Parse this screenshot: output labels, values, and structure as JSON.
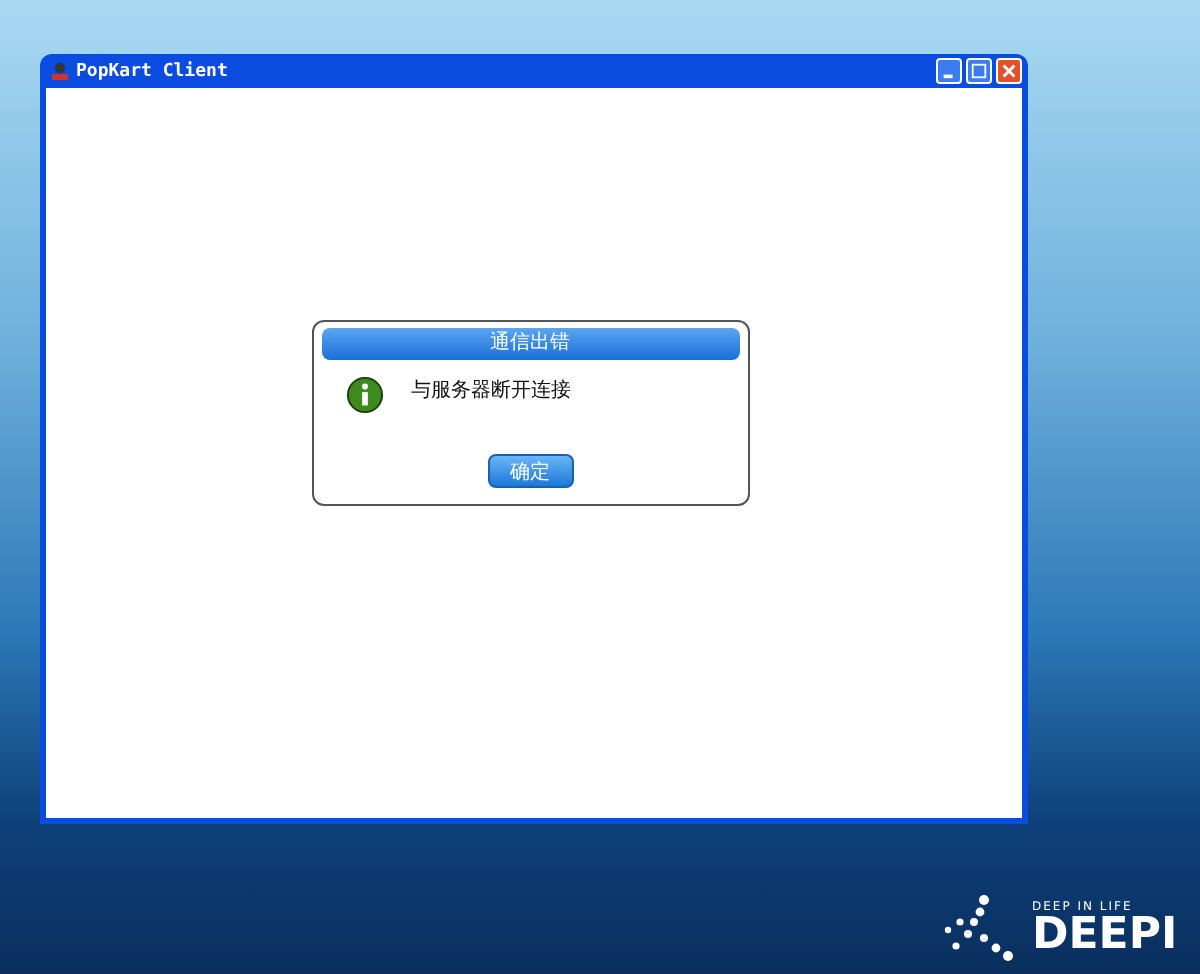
{
  "window": {
    "title": "PopKart Client"
  },
  "dialog": {
    "title": "通信出错",
    "message": "与服务器断开连接",
    "button": "确定"
  },
  "desktop_logo": {
    "tagline": "DEEP IN LIFE",
    "wordmark": "DEEPI"
  }
}
